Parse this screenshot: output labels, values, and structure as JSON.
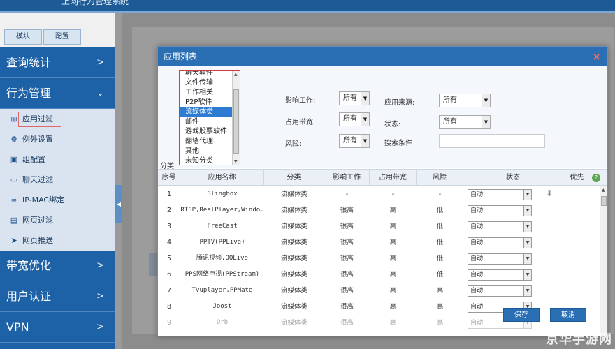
{
  "header": {
    "title": "上网行为管理系统"
  },
  "sidebar": {
    "tabs": [
      "模块",
      "配置"
    ],
    "menus": [
      {
        "label": "查询统计",
        "chevron": ">"
      },
      {
        "label": "行为管理",
        "chevron": "v"
      }
    ],
    "sub_items": [
      {
        "label": "应用过滤",
        "icon": "grid-icon"
      },
      {
        "label": "例外设置",
        "icon": "gear-icon"
      },
      {
        "label": "组配置",
        "icon": "group-icon"
      },
      {
        "label": "聊天过滤",
        "icon": "chat-icon"
      },
      {
        "label": "IP-MAC绑定",
        "icon": "link-icon"
      },
      {
        "label": "网页过滤",
        "icon": "page-icon"
      },
      {
        "label": "网页推送",
        "icon": "send-icon"
      }
    ],
    "menus_after": [
      {
        "label": "带宽优化",
        "chevron": ">"
      },
      {
        "label": "用户认证",
        "chevron": ">"
      },
      {
        "label": "VPN",
        "chevron": ">"
      }
    ]
  },
  "modal": {
    "title": "应用列表",
    "close": "×",
    "category_label": "分类:",
    "categories": [
      "聊天软件",
      "文件传输",
      "工作相关",
      "P2P软件",
      "流媒体类",
      "邮件",
      "游戏股票软件",
      "翻墙代理",
      "其他",
      "未知分类"
    ],
    "selected_category": "流媒体类",
    "filters": {
      "impact_work": {
        "label": "影响工作:",
        "value": "所有"
      },
      "bandwidth": {
        "label": "占用带宽:",
        "value": "所有"
      },
      "risk": {
        "label": "风险:",
        "value": "所有"
      },
      "source": {
        "label": "应用来源:",
        "value": "所有"
      },
      "status": {
        "label": "状态:",
        "value": "所有"
      },
      "search": {
        "label": "搜索条件",
        "value": ""
      }
    },
    "columns": [
      "序号",
      "应用名称",
      "分类",
      "影响工作",
      "占用带宽",
      "风险",
      "状态",
      "优先"
    ],
    "rows": [
      {
        "no": "1",
        "name": "Slingbox",
        "category": "流媒体类",
        "impact": "-",
        "bandwidth": "-",
        "risk": "-",
        "status": "自动",
        "download": true
      },
      {
        "no": "2",
        "name": "RTSP,RealPlayer,Windo…",
        "category": "流媒体类",
        "impact": "很高",
        "bandwidth": "高",
        "risk": "低",
        "status": "自动"
      },
      {
        "no": "3",
        "name": "FreeCast",
        "category": "流媒体类",
        "impact": "很高",
        "bandwidth": "高",
        "risk": "低",
        "status": "自动"
      },
      {
        "no": "4",
        "name": "PPTV(PPLive)",
        "category": "流媒体类",
        "impact": "很高",
        "bandwidth": "高",
        "risk": "低",
        "status": "自动"
      },
      {
        "no": "5",
        "name": "腾讯视频,QQLive",
        "category": "流媒体类",
        "impact": "很高",
        "bandwidth": "高",
        "risk": "低",
        "status": "自动"
      },
      {
        "no": "6",
        "name": "PPS网络电视(PPStream)",
        "category": "流媒体类",
        "impact": "很高",
        "bandwidth": "高",
        "risk": "低",
        "status": "自动"
      },
      {
        "no": "7",
        "name": "Tvuplayer,PPMate",
        "category": "流媒体类",
        "impact": "很高",
        "bandwidth": "高",
        "risk": "高",
        "status": "自动"
      },
      {
        "no": "8",
        "name": "Joost",
        "category": "流媒体类",
        "impact": "很高",
        "bandwidth": "高",
        "risk": "高",
        "status": "自动"
      },
      {
        "no": "9",
        "name": "Orb",
        "category": "流媒体类",
        "impact": "很高",
        "bandwidth": "高",
        "risk": "高",
        "status": "自动"
      }
    ],
    "buttons": {
      "save": "保存",
      "cancel": "取消"
    }
  },
  "watermark": "京华手游网"
}
